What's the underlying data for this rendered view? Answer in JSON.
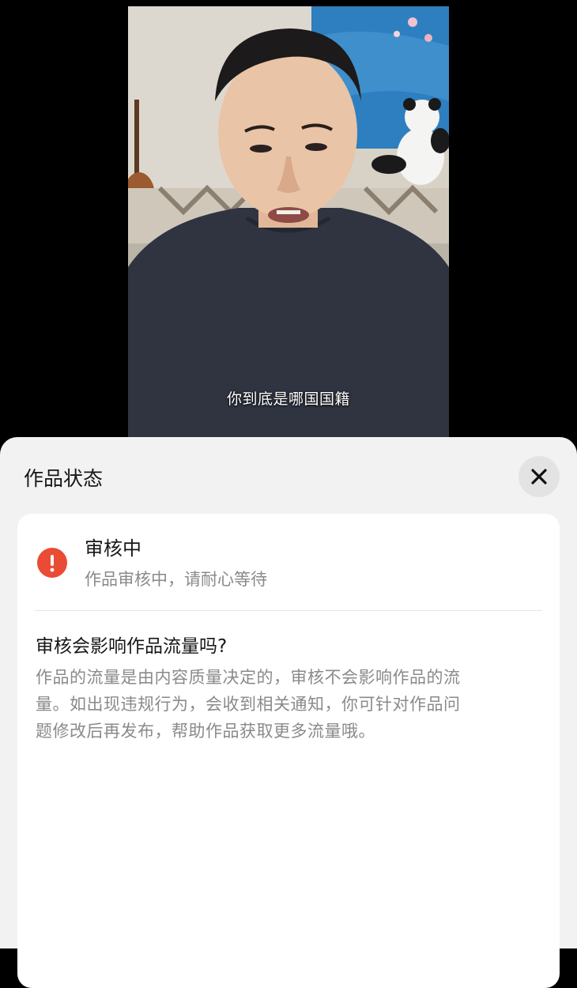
{
  "video": {
    "subtitle": "你到底是哪国国籍"
  },
  "sheet": {
    "title": "作品状态",
    "close_icon": "close-icon",
    "status": {
      "icon": "exclamation-icon",
      "icon_color": "#e94b35",
      "title": "审核中",
      "description": "作品审核中，请耐心等待"
    },
    "faq": {
      "question": "审核会影响作品流量吗?",
      "answer_lines": [
        "作品的流量是由内容质量决定的，审核不会影响作品的流",
        "量。如出现违规行为，会收到相关通知，你可针对作品问",
        "题修改后再发布，帮助作品获取更多流量哦。"
      ]
    }
  }
}
